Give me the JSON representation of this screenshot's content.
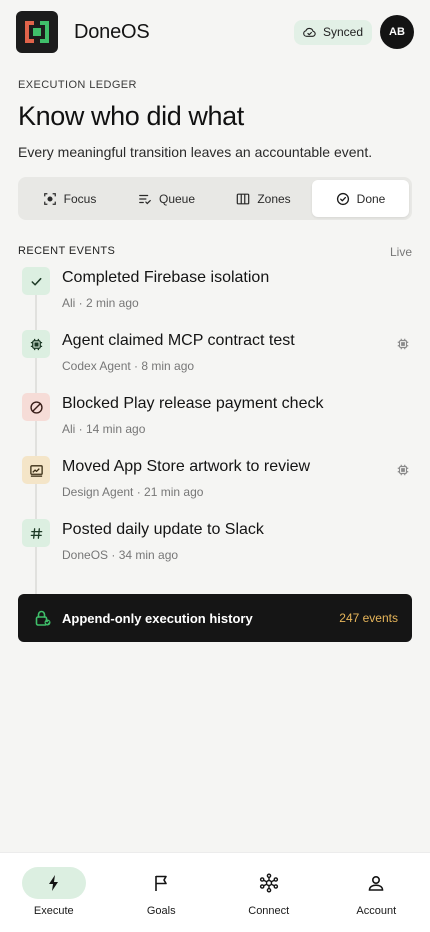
{
  "app": {
    "name": "DoneOS",
    "sync_status": "Synced",
    "avatar_initials": "AB"
  },
  "hero": {
    "overline": "EXECUTION LEDGER",
    "headline": "Know who did what",
    "subtext": "Every meaningful transition leaves an accountable event."
  },
  "tabs": [
    {
      "label": "Focus",
      "icon": "focus-icon"
    },
    {
      "label": "Queue",
      "icon": "queue-icon"
    },
    {
      "label": "Zones",
      "icon": "zones-icon"
    },
    {
      "label": "Done",
      "icon": "check-circle-icon",
      "active": true
    }
  ],
  "recent": {
    "title": "RECENT EVENTS",
    "live_label": "Live",
    "events": [
      {
        "title": "Completed Firebase isolation",
        "meta": "Ali · 2 min ago",
        "icon": "check-icon",
        "tone": "green",
        "agent_chip": false
      },
      {
        "title": "Agent claimed MCP contract test",
        "meta": "Codex Agent · 8 min ago",
        "icon": "chip-icon",
        "tone": "green",
        "agent_chip": true
      },
      {
        "title": "Blocked Play release payment check",
        "meta": "Ali · 14 min ago",
        "icon": "blocked-icon",
        "tone": "red",
        "agent_chip": false
      },
      {
        "title": "Moved App Store artwork to review",
        "meta": "Design Agent · 21 min ago",
        "icon": "image-review-icon",
        "tone": "amber",
        "agent_chip": true
      },
      {
        "title": "Posted daily update to Slack",
        "meta": "DoneOS · 34 min ago",
        "icon": "hash-icon",
        "tone": "green",
        "agent_chip": false
      }
    ]
  },
  "history": {
    "label": "Append-only execution history",
    "count": "247 events"
  },
  "nav": [
    {
      "label": "Execute",
      "icon": "bolt-icon",
      "active": true
    },
    {
      "label": "Goals",
      "icon": "flag-icon"
    },
    {
      "label": "Connect",
      "icon": "network-icon"
    },
    {
      "label": "Account",
      "icon": "user-icon"
    }
  ],
  "colors": {
    "accent_green": "#dcefe1",
    "logo_red": "#e0634a",
    "logo_green": "#3fbf6a",
    "history_count": "#e6b55a",
    "dark": "#151515"
  }
}
